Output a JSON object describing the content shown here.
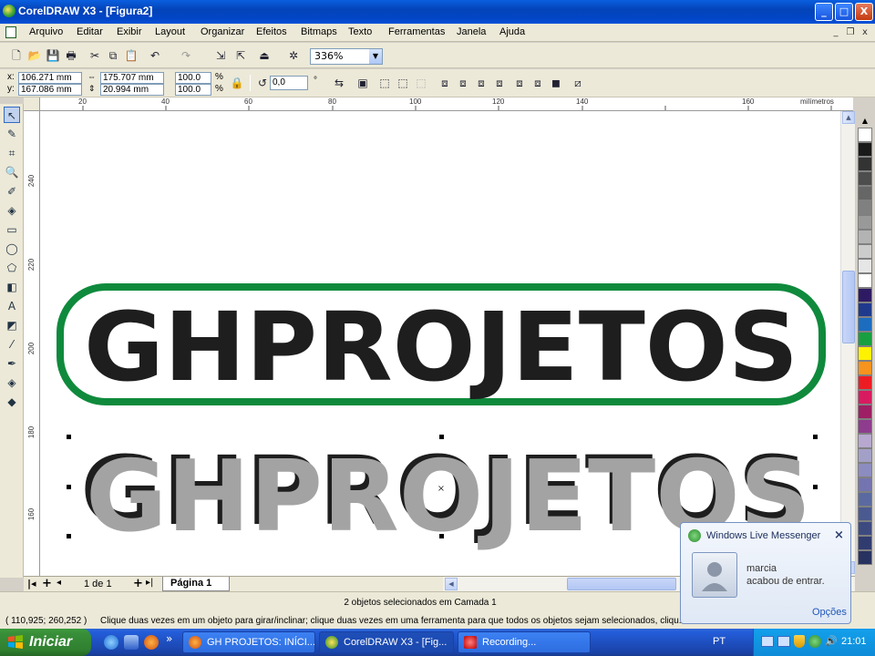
{
  "window": {
    "title": "CorelDRAW X3 - [Figura2]"
  },
  "title_buttons": {
    "minimize": "_",
    "maximize": "□",
    "close": "X"
  },
  "menu": [
    "Arquivo",
    "Editar",
    "Exibir",
    "Layout",
    "Organizar",
    "Efeitos",
    "Bitmaps",
    "Texto",
    "Ferramentas",
    "Janela",
    "Ajuda"
  ],
  "mdi_buttons": {
    "minimize": "_",
    "restore": "❐",
    "close": "x"
  },
  "standard_toolbar": {
    "zoom": "336%"
  },
  "property_bar": {
    "x_label": "x:",
    "x_value": "106.271 mm",
    "y_label": "y:",
    "y_value": "167.086 mm",
    "width_value": "175.707 mm",
    "height_value": "20.994 mm",
    "scale_x": "100.0",
    "scale_y": "100.0",
    "pct1": "%",
    "pct2": "%",
    "rotation": "0,0",
    "degree": "°"
  },
  "ruler": {
    "unit": "milímetros",
    "top_ticks": [
      "20",
      "40",
      "60",
      "80",
      "100",
      "120",
      "140",
      "160"
    ],
    "left_ticks": [
      "240",
      "220",
      "200",
      "180",
      "160"
    ]
  },
  "canvas": {
    "logo_text": "GHPROJETOS",
    "logo_text_2": "GHPROJETOS",
    "colors": {
      "outline_green": "#0f8a3c",
      "fill_dark": "#1e1e1e",
      "fill_gray": "#a3a3a3"
    }
  },
  "page_nav": {
    "page_count": "1 de 1",
    "page_tab": "Página 1"
  },
  "status": {
    "selection_info": "2 objetos selecionados em Camada 1",
    "coords": "( 110,925; 260,252 )",
    "hint": "Clique duas vezes em um objeto para girar/inclinar; clique duas vezes em uma ferramenta para que todos os objetos sejam selecionados, cliqu..."
  },
  "messenger": {
    "header": "Windows Live Messenger",
    "contact": "marcia",
    "message": "acabou de entrar.",
    "options_link": "Opções",
    "close": "×"
  },
  "taskbar": {
    "start": "Iniciar",
    "tasks": [
      "GH PROJETOS: INÍCI...",
      "CorelDRAW X3 - [Fig...",
      "Recording..."
    ],
    "language": "PT",
    "time": "21:01",
    "chevron": "»"
  },
  "palette": [
    "#ffffff",
    "#1a1a1a",
    "#333333",
    "#4d4d4d",
    "#666666",
    "#808080",
    "#999999",
    "#b3b3b3",
    "#cccccc",
    "#e6e6e6",
    "#ffffff",
    "#2e1a63",
    "#1f3a8c",
    "#1c6cc0",
    "#18a040",
    "#fff200",
    "#f7941d",
    "#ed1c24",
    "#d81b60",
    "#9e1f63",
    "#8e3c8e",
    "#b8a8d0",
    "#a3a0c8",
    "#8c8cc0",
    "#7474b0",
    "#5a6aa0",
    "#4a5a90",
    "#3c4a80",
    "#303c70",
    "#283260"
  ]
}
